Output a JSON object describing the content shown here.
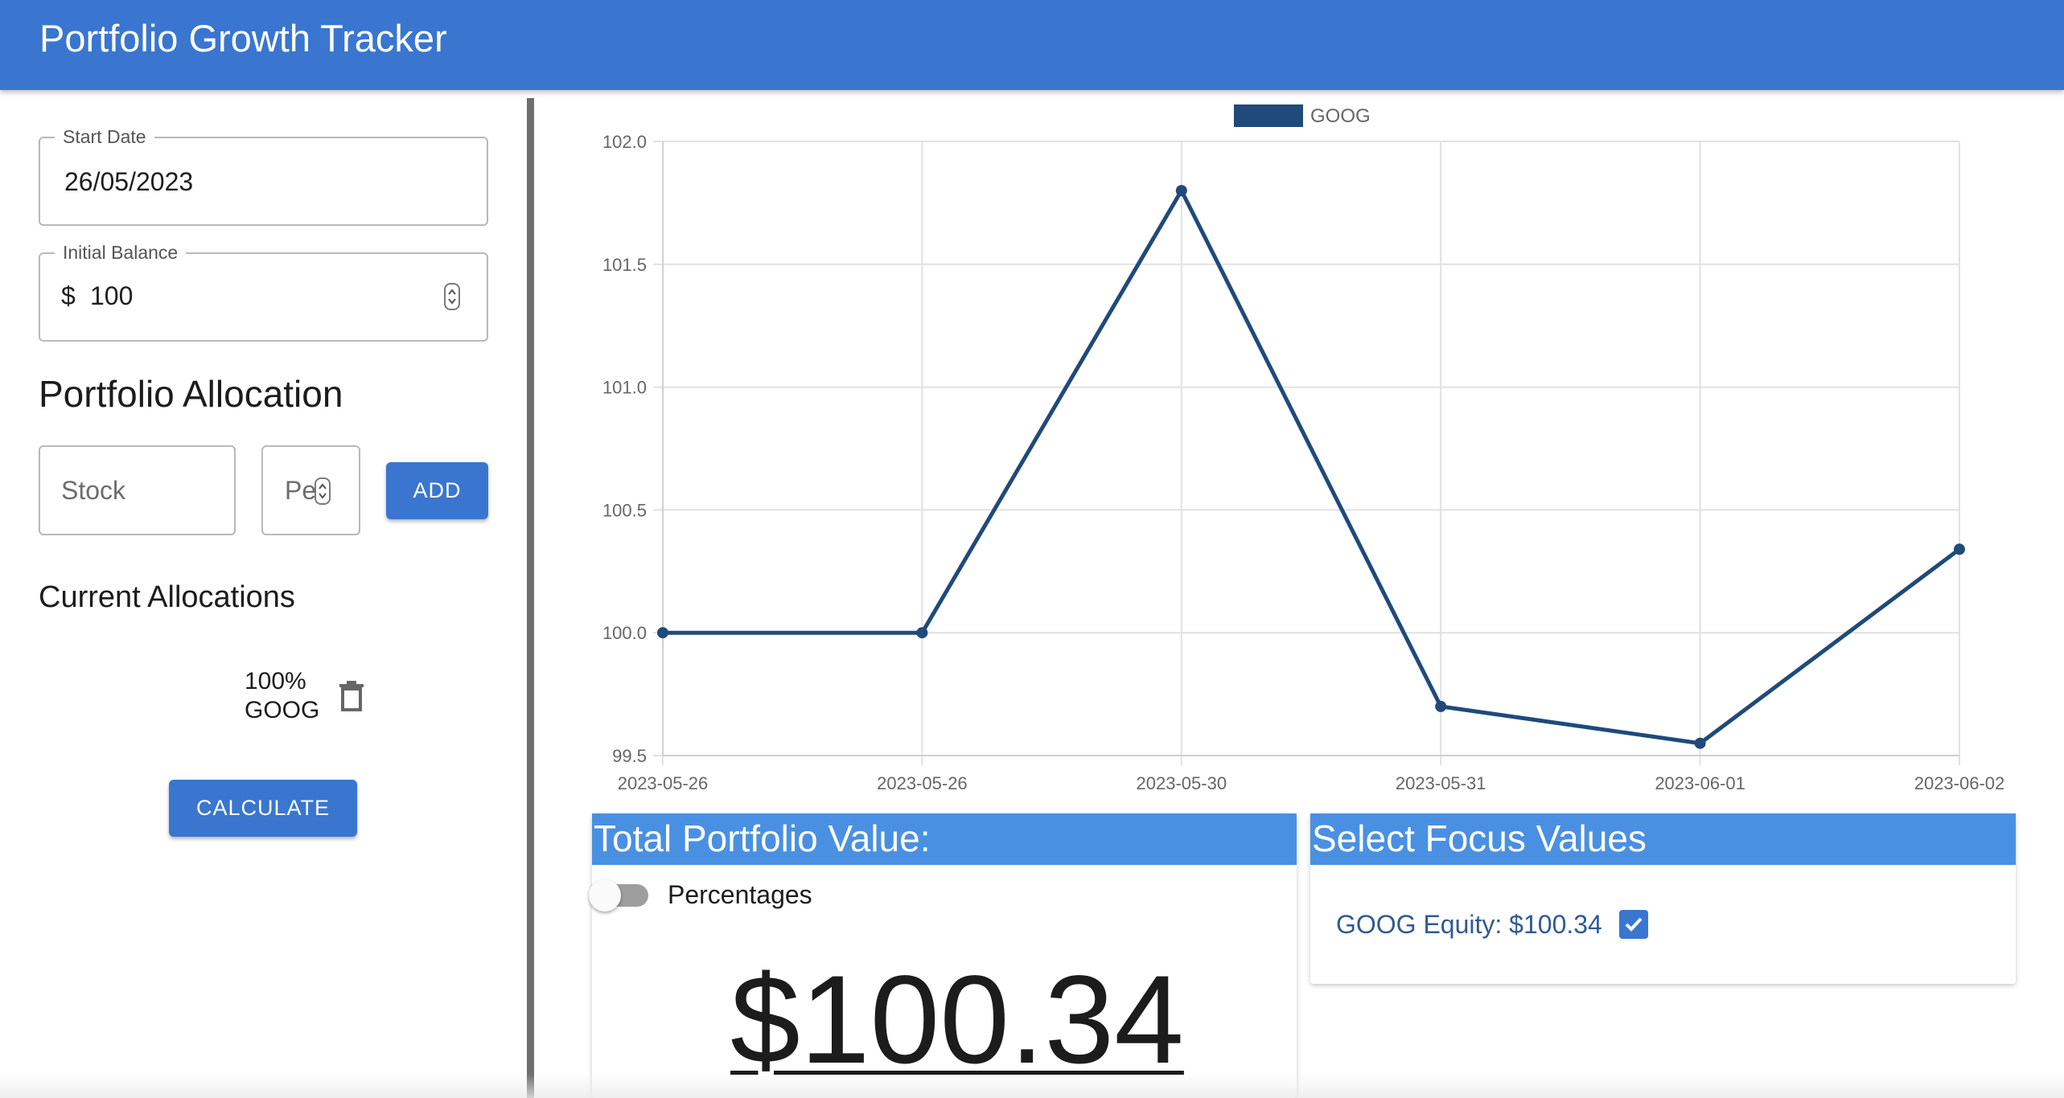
{
  "app": {
    "title": "Portfolio Growth Tracker"
  },
  "form": {
    "start_date": {
      "label": "Start Date",
      "value": "26/05/2023"
    },
    "initial_balance": {
      "label": "Initial Balance",
      "currency": "$",
      "value": "100"
    },
    "allocation_title": "Portfolio Allocation",
    "stock_placeholder": "Stock",
    "percent_placeholder": "Pe",
    "add_label": "ADD",
    "current_title": "Current Allocations",
    "allocations": [
      {
        "percent": "100%",
        "ticker": "GOOG"
      }
    ],
    "calculate_label": "CALCULATE"
  },
  "chart_data": {
    "type": "line",
    "x": [
      "2023-05-26",
      "2023-05-26",
      "2023-05-30",
      "2023-05-31",
      "2023-06-01",
      "2023-06-02"
    ],
    "series": [
      {
        "name": "GOOG",
        "values": [
          100.0,
          100.0,
          101.8,
          99.7,
          99.55,
          100.34
        ],
        "color": "#1f4a7a"
      }
    ],
    "ylim": [
      99.5,
      102.0
    ],
    "yticks": [
      "102.0",
      "101.5",
      "101.0",
      "100.5",
      "100.0",
      "99.5"
    ],
    "grid": true,
    "legend": "top-center"
  },
  "total_card": {
    "title": "Total Portfolio Value:",
    "toggle_label": "Percentages",
    "toggle_on": false,
    "value": "$100.34"
  },
  "focus_card": {
    "title": "Select Focus Values",
    "items": [
      {
        "label": "GOOG Equity: $100.34",
        "checked": true
      }
    ]
  },
  "colors": {
    "appbar": "#3a76cf",
    "card_header": "#4a90e2",
    "series": "#1f4a7a"
  },
  "icons": {
    "delete": "trash-icon",
    "checkbox": "check-icon"
  }
}
